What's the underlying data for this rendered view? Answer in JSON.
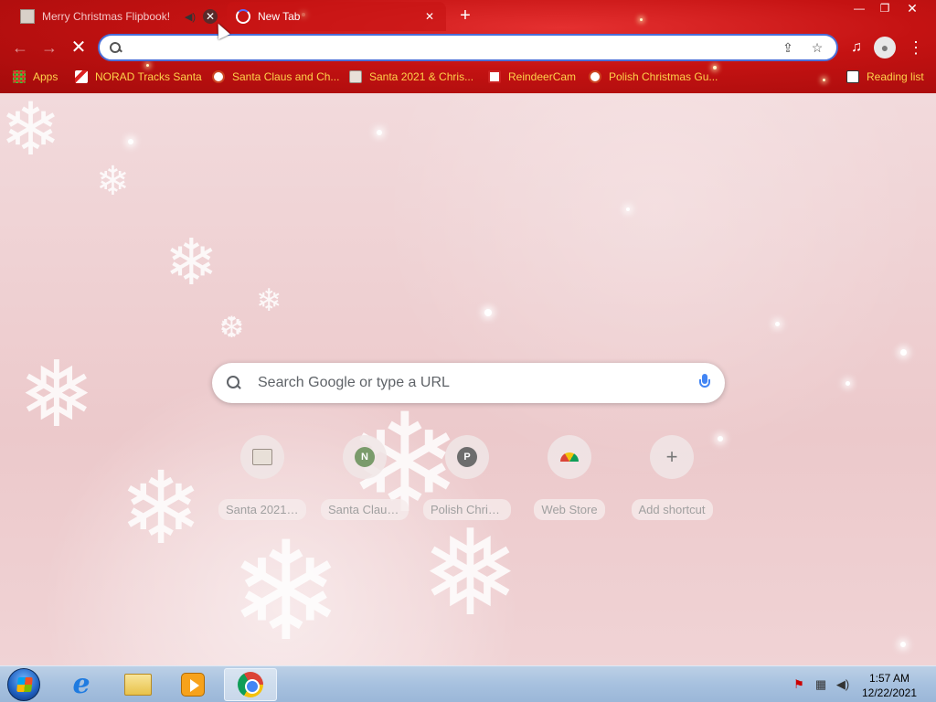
{
  "browser": {
    "tabs": [
      {
        "title": "Merry Christmas Flipbook!",
        "active": false,
        "favicon": "page-thumb-icon",
        "audio": true
      },
      {
        "title": "New Tab",
        "active": true,
        "favicon": "loading-spinner-icon"
      }
    ],
    "new_tab_symbol": "+",
    "window_controls": {
      "minimize": "—",
      "maximize": "❐",
      "close": "✕"
    },
    "toolbar": {
      "back_symbol": "←",
      "forward_symbol": "→",
      "stop_symbol": "✕",
      "omnibox_value": "",
      "share_symbol": "⇪",
      "bookmark_symbol": "☆",
      "media_symbol": "♫",
      "profile_symbol": "●",
      "menu_symbol": "⋮"
    },
    "bookmarks": [
      {
        "label": "Apps",
        "icon": "apps-grid-icon"
      },
      {
        "label": "NORAD Tracks Santa",
        "icon": "candy-cane-icon"
      },
      {
        "label": "Santa Claus and Ch...",
        "icon": "globe-icon"
      },
      {
        "label": "Santa 2021 & Chris...",
        "icon": "page-thumb-icon"
      },
      {
        "label": "ReindeerCam",
        "icon": "reindeer-icon"
      },
      {
        "label": "Polish Christmas Gu...",
        "icon": "globe-icon"
      },
      {
        "label": "Reading list",
        "icon": "reading-list-icon"
      }
    ]
  },
  "ntp": {
    "search_placeholder": "Search Google or type a URL",
    "shortcuts": [
      {
        "title": "Santa 2021 &...",
        "icon": "page-thumb-icon",
        "letter": ""
      },
      {
        "title": "Santa Claus ...",
        "icon": "letter-n-icon",
        "letter": "N",
        "color": "#7a9b6b"
      },
      {
        "title": "Polish Christ...",
        "icon": "letter-p-icon",
        "letter": "P",
        "color": "#6d6d6d"
      },
      {
        "title": "Web Store",
        "icon": "webstore-icon",
        "letter": ""
      },
      {
        "title": "Add shortcut",
        "icon": "add-icon",
        "letter": "+"
      }
    ]
  },
  "taskbar": {
    "apps": [
      {
        "name": "Internet Explorer",
        "icon": "ie-icon"
      },
      {
        "name": "Windows Explorer",
        "icon": "folder-icon"
      },
      {
        "name": "Media Player",
        "icon": "media-player-icon"
      },
      {
        "name": "Google Chrome",
        "icon": "chrome-icon",
        "active": true
      }
    ],
    "clock_time": "1:57 AM",
    "clock_date": "12/22/2021"
  },
  "colors": {
    "chrome_red": "#c41212",
    "bookmark_text": "#ffd24a",
    "omnibox_focus": "#4a6fd8",
    "taskbar": "#a7c1df"
  }
}
